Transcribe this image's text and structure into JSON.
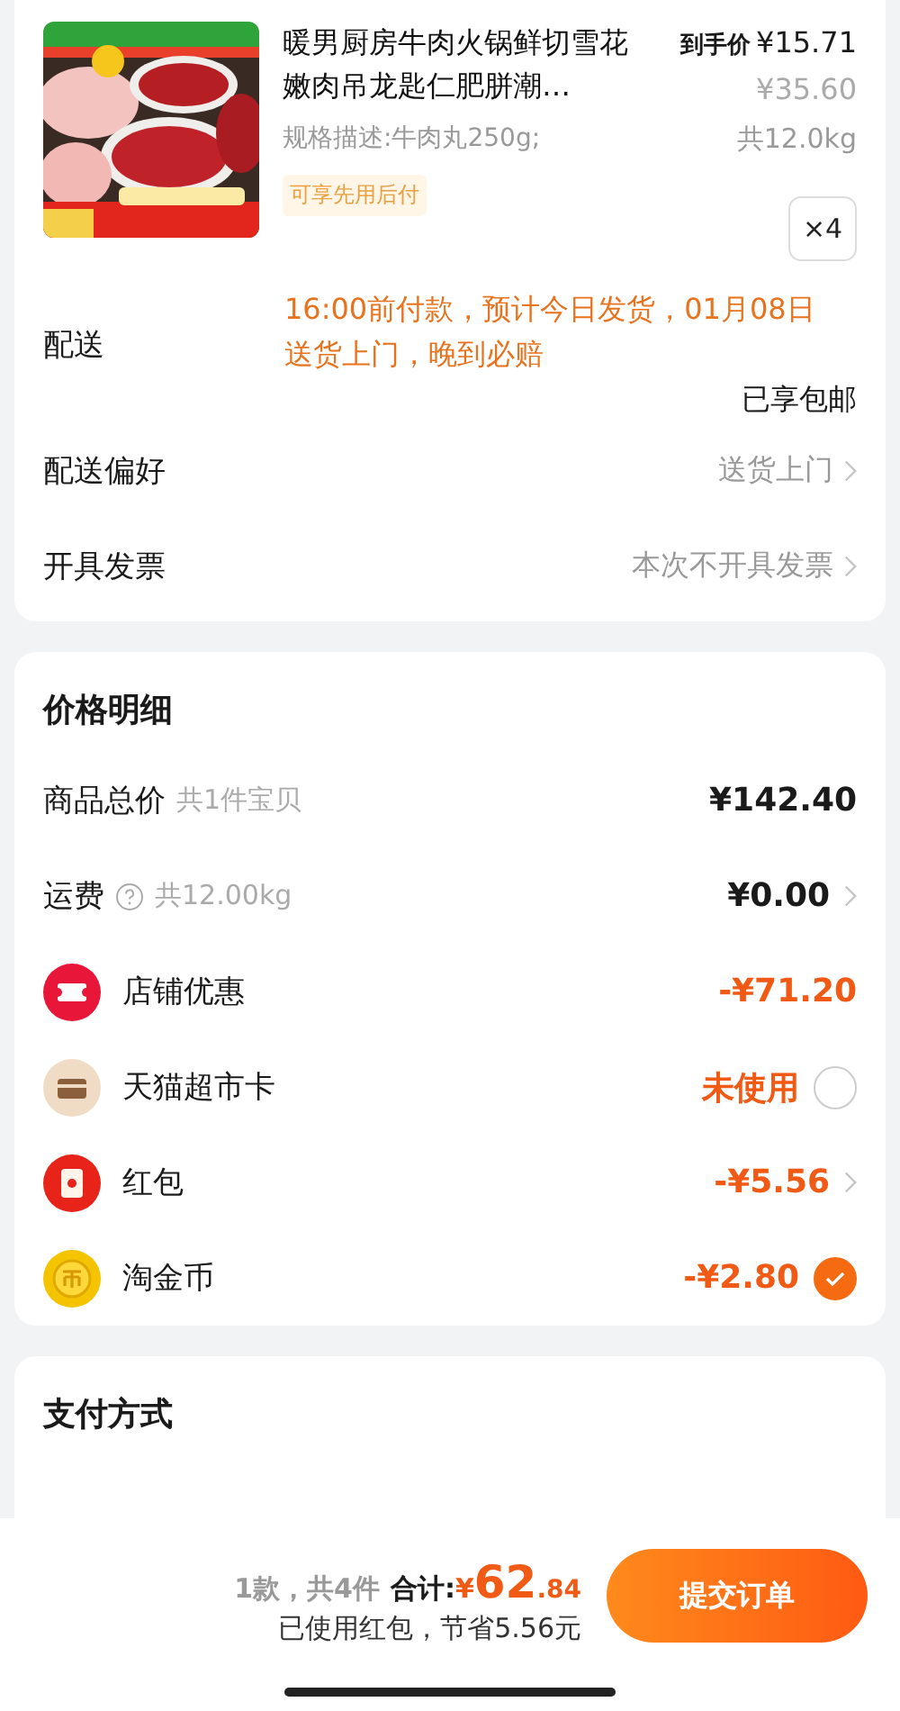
{
  "product": {
    "title": "暖男厨房牛肉火锅鲜切雪花嫩肉吊龙匙仁肥胼潮…",
    "deal_price_label": "到手价",
    "deal_price": "¥15.71",
    "original_price": "¥35.60",
    "spec": "规格描述:牛肉丸250g;",
    "weight": "共12.0kg",
    "tag": "可享先用后付",
    "quantity": "×4"
  },
  "delivery": {
    "label": "配送",
    "notice": "16:00前付款，预计今日发货，01月08日送货上门，晚到必赔",
    "shipping": "已享包邮"
  },
  "options": [
    {
      "label": "配送偏好",
      "value": "送货上门"
    },
    {
      "label": "开具发票",
      "value": "本次不开具发票"
    }
  ],
  "price_details": {
    "title": "价格明细",
    "rows": [
      {
        "kind": "total",
        "label": "商品总价",
        "note": "共1件宝贝",
        "amount": "¥142.40",
        "chevron": false
      },
      {
        "kind": "fee",
        "label": "运费",
        "note": "共12.00kg",
        "amount": "¥0.00",
        "chevron": true
      },
      {
        "kind": "store_discount",
        "label": "店铺优惠",
        "amount": "-¥71.20",
        "chevron": false
      },
      {
        "kind": "gift_card",
        "label": "天猫超市卡",
        "amount": "未使用",
        "checked": false,
        "chevron": false
      },
      {
        "kind": "hongbao",
        "label": "红包",
        "amount": "-¥5.56",
        "chevron": true
      },
      {
        "kind": "coins",
        "label": "淘金币",
        "amount": "-¥2.80",
        "checked": true,
        "chevron": false
      }
    ]
  },
  "payment": {
    "title": "支付方式"
  },
  "footer": {
    "count": "1款，共4件",
    "total_label": "合计:",
    "currency": "¥",
    "total_int": "62",
    "total_dec": ".84",
    "savings": "已使用红包，节省5.56元",
    "submit": "提交订单"
  }
}
